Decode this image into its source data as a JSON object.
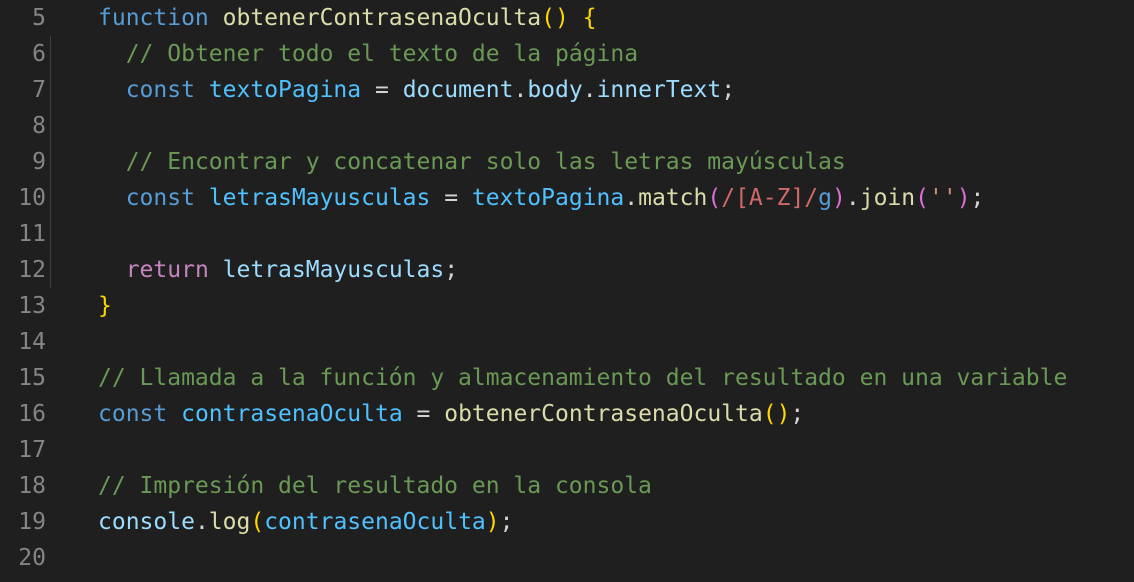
{
  "editor": {
    "lines": [
      {
        "num": "5"
      },
      {
        "num": "6"
      },
      {
        "num": "7"
      },
      {
        "num": "8"
      },
      {
        "num": "9"
      },
      {
        "num": "10"
      },
      {
        "num": "11"
      },
      {
        "num": "12"
      },
      {
        "num": "13"
      },
      {
        "num": "14"
      },
      {
        "num": "15"
      },
      {
        "num": "16"
      },
      {
        "num": "17"
      },
      {
        "num": "18"
      },
      {
        "num": "19"
      },
      {
        "num": "20"
      }
    ],
    "tokens": {
      "kw_function": "function",
      "fn_obtener": "obtenerContrasenaOculta",
      "parens_open_close": "()",
      "brace_open": "{",
      "brace_close": "}",
      "cmt_obtener": "// Obtener todo el texto de la página",
      "kw_const": "const",
      "var_textoPagina": "textoPagina",
      "op_eq": " = ",
      "var_document": "document",
      "dot": ".",
      "var_body": "body",
      "var_innerText": "innerText",
      "semi": ";",
      "cmt_encontrar": "// Encontrar y concatenar solo las letras mayúsculas",
      "var_letras": "letrasMayusculas",
      "fn_match": "match",
      "paren_open": "(",
      "paren_close": ")",
      "regex_body": "/[A-Z]/",
      "regex_flag": "g",
      "fn_join": "join",
      "str_empty": "''",
      "kw_return": "return",
      "cmt_llamada": "// Llamada a la función y almacenamiento del resultado en una variable",
      "var_contrasena": "contrasenaOculta",
      "cmt_impresion": "// Impresión del resultado en la consola",
      "var_console": "console",
      "fn_log": "log"
    },
    "colors": {
      "background": "#1f1f1f",
      "line_number": "#858585",
      "keyword": "#569cd6",
      "control_keyword": "#c586c0",
      "function": "#dcdcaa",
      "variable": "#9cdcfe",
      "constant": "#4fc1ff",
      "comment": "#6a9955",
      "bracket_level1": "#ffd700",
      "bracket_level2": "#da70d6",
      "bracket_level3": "#179fff",
      "string": "#ce9178",
      "regex": "#d16969"
    }
  }
}
